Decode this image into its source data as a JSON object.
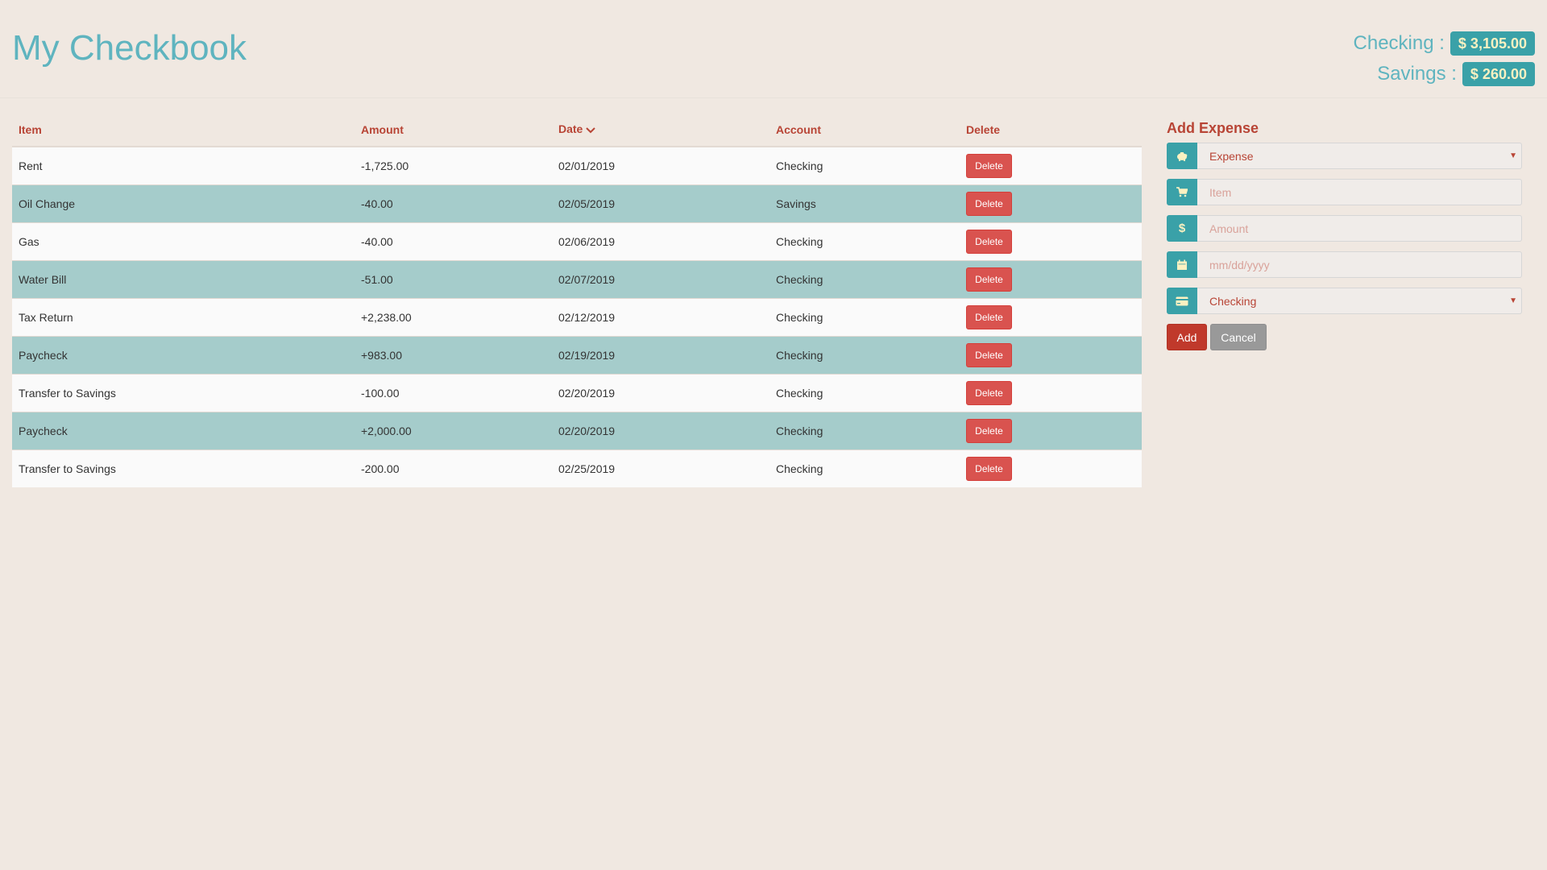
{
  "header": {
    "title": "My Checkbook",
    "balances": [
      {
        "label": "Checking :",
        "value": "$ 3,105.00"
      },
      {
        "label": "Savings :",
        "value": "$ 260.00"
      }
    ]
  },
  "table": {
    "columns": {
      "item": "Item",
      "amount": "Amount",
      "date": "Date",
      "account": "Account",
      "delete": "Delete"
    },
    "sort": {
      "column": "date",
      "direction": "descending-icon"
    },
    "rows": [
      {
        "item": "Rent",
        "amount": "-1,725.00",
        "date": "02/01/2019",
        "account": "Checking",
        "action": "Delete"
      },
      {
        "item": "Oil Change",
        "amount": "-40.00",
        "date": "02/05/2019",
        "account": "Savings",
        "action": "Delete"
      },
      {
        "item": "Gas",
        "amount": "-40.00",
        "date": "02/06/2019",
        "account": "Checking",
        "action": "Delete"
      },
      {
        "item": "Water Bill",
        "amount": "-51.00",
        "date": "02/07/2019",
        "account": "Checking",
        "action": "Delete"
      },
      {
        "item": "Tax Return",
        "amount": "+2,238.00",
        "date": "02/12/2019",
        "account": "Checking",
        "action": "Delete"
      },
      {
        "item": "Paycheck",
        "amount": "+983.00",
        "date": "02/19/2019",
        "account": "Checking",
        "action": "Delete"
      },
      {
        "item": "Transfer to Savings",
        "amount": "-100.00",
        "date": "02/20/2019",
        "account": "Checking",
        "action": "Delete"
      },
      {
        "item": "Paycheck",
        "amount": "+2,000.00",
        "date": "02/20/2019",
        "account": "Checking",
        "action": "Delete"
      },
      {
        "item": "Transfer to Savings",
        "amount": "-200.00",
        "date": "02/25/2019",
        "account": "Checking",
        "action": "Delete"
      }
    ]
  },
  "form": {
    "title": "Add Expense",
    "type_select": {
      "value": "Expense",
      "icon": "piggy-bank-icon"
    },
    "item_input": {
      "placeholder": "Item",
      "icon": "shopping-cart-icon"
    },
    "amount_input": {
      "placeholder": "Amount",
      "icon": "dollar-icon"
    },
    "date_input": {
      "placeholder": "mm/dd/yyyy",
      "icon": "calendar-icon"
    },
    "account_select": {
      "value": "Checking",
      "icon": "credit-card-icon"
    },
    "add_label": "Add",
    "cancel_label": "Cancel"
  },
  "colors": {
    "accent": "#5fb4bf",
    "badge": "#3aa1a8",
    "header_text": "#b84435",
    "row_alt": "#a5cccb",
    "delete": "#d9534f",
    "add": "#c0392b",
    "cancel": "#999999",
    "background": "#f0e8e1"
  }
}
